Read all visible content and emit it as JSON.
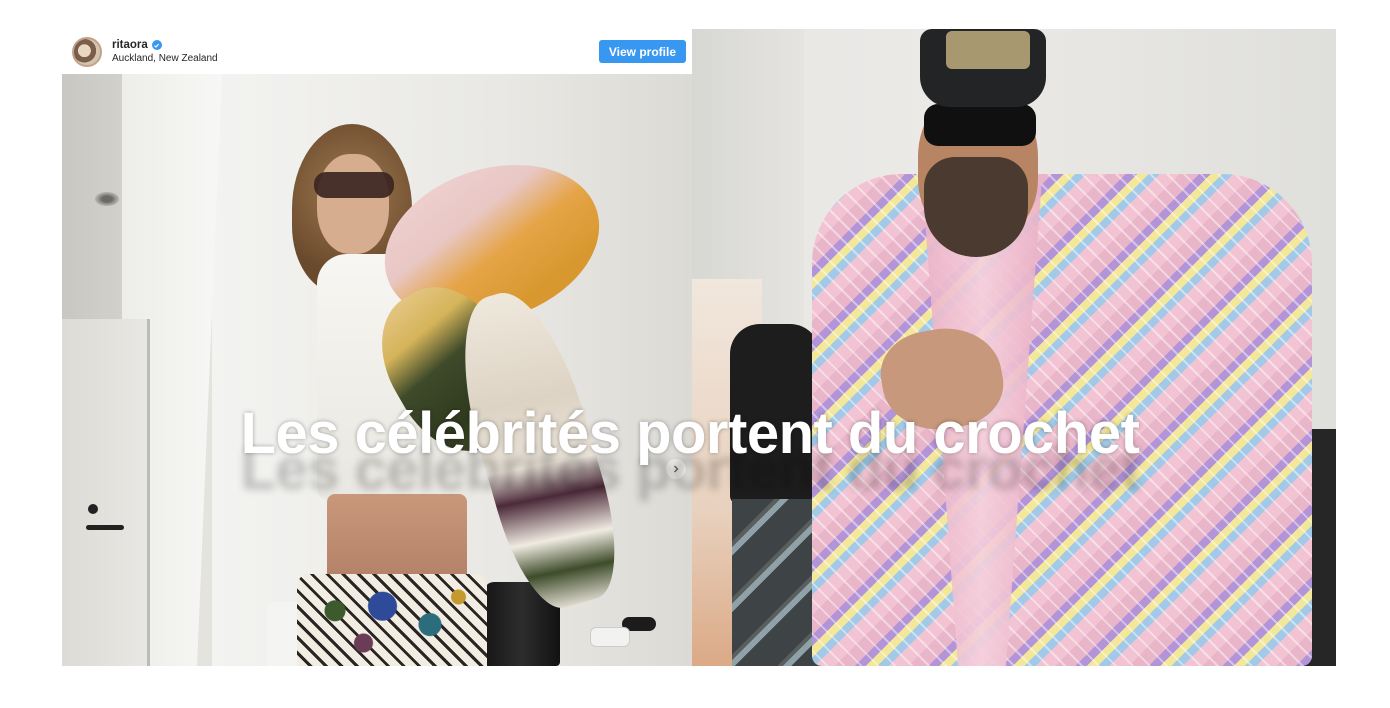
{
  "embed": {
    "username": "ritaora",
    "verified": true,
    "location": "Auckland, New Zealand",
    "view_profile_label": "View profile"
  },
  "headline": "Les célébrités portent du crochet",
  "colors": {
    "view_profile_bg": "#3897f0",
    "verified_badge": "#3897f0",
    "headline_text": "#ffffff"
  },
  "icons": {
    "verified": "verified-badge-icon",
    "carousel_next": "chevron-right-icon"
  }
}
